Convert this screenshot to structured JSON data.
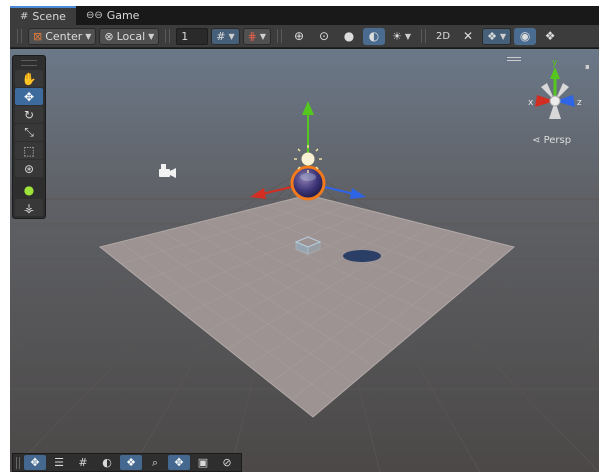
{
  "tabs": [
    {
      "label": "Scene",
      "icon": "grid-icon",
      "glyph": "#"
    },
    {
      "label": "Game",
      "icon": "gamepad-icon",
      "glyph": "⊖⊖"
    }
  ],
  "toolbar": {
    "pivot_label": "Center",
    "pivot_glyph": "⊠",
    "space_label": "Local",
    "space_glyph": "⊗",
    "grid_size_value": "1",
    "grid_glyph": "#",
    "snap_glyph": "⋕",
    "global_glyph": "⊕",
    "local_glyph": "⊙",
    "shaded_glyph": "●",
    "wireframe_glyph": "◐",
    "lighting_glyph": "☀",
    "mode_2d_label": "2D",
    "audio_glyph": "✕",
    "effects_glyph": "❖",
    "visibility_glyph": "◉",
    "layers_glyph": "❖"
  },
  "tools": [
    {
      "name": "hand",
      "glyph": "✋",
      "active": false
    },
    {
      "name": "move",
      "glyph": "✥",
      "active": true
    },
    {
      "name": "rotate",
      "glyph": "↻",
      "active": false
    },
    {
      "name": "scale",
      "glyph": "⤡",
      "active": false
    },
    {
      "name": "rect",
      "glyph": "⬚",
      "active": false
    },
    {
      "name": "transform",
      "glyph": "⊛",
      "active": false
    },
    {
      "name": "custom",
      "glyph": "●",
      "active": false
    },
    {
      "name": "bones",
      "glyph": "⚶",
      "active": false
    }
  ],
  "overlay_tools": [
    {
      "name": "move",
      "glyph": "✥",
      "on": true
    },
    {
      "name": "scene-view",
      "glyph": "☰",
      "on": false
    },
    {
      "name": "grid",
      "glyph": "#",
      "on": false
    },
    {
      "name": "shading",
      "glyph": "◐",
      "on": false
    },
    {
      "name": "layers",
      "glyph": "❖",
      "on": true
    },
    {
      "name": "search",
      "glyph": "⌕",
      "on": false
    },
    {
      "name": "transform",
      "glyph": "✥",
      "on": true
    },
    {
      "name": "camera",
      "glyph": "▣",
      "on": false
    },
    {
      "name": "compass",
      "glyph": "⊘",
      "on": false
    }
  ],
  "gizmo": {
    "persp_label": "Persp",
    "axis_y": "y",
    "axis_x": "x",
    "axis_z": "z",
    "lock_glyph": "🔒"
  },
  "colors": {
    "x_axis": "#d22e22",
    "y_axis": "#55c81f",
    "z_axis": "#2e64e6",
    "plane": "#9d9392",
    "sky_top": "#6c7989",
    "ground": "#4a4746"
  }
}
